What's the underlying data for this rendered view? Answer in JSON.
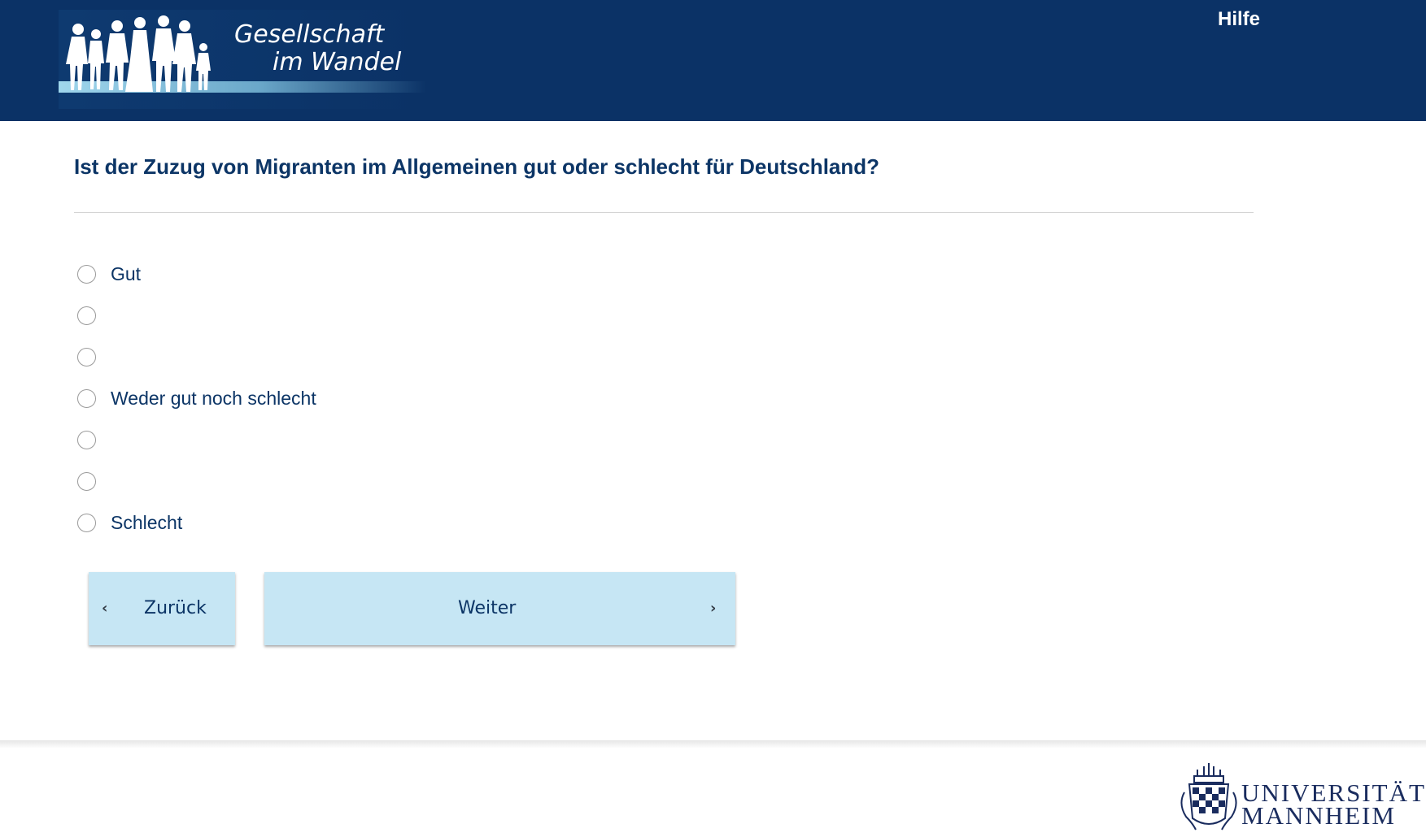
{
  "header": {
    "logo_line1": "Gesellschaft",
    "logo_line2": "im Wandel",
    "help_label": "Hilfe",
    "bg_color": "#0b3266"
  },
  "question": {
    "text": "Ist der Zuzug von Migranten im Allgemeinen gut oder schlecht für Deutschland?"
  },
  "options": [
    {
      "label": "Gut",
      "selected": false
    },
    {
      "label": "",
      "selected": false
    },
    {
      "label": "",
      "selected": false
    },
    {
      "label": "Weder gut noch schlecht",
      "selected": false
    },
    {
      "label": "",
      "selected": false
    },
    {
      "label": "",
      "selected": false
    },
    {
      "label": "Schlecht",
      "selected": false
    }
  ],
  "navigation": {
    "back_label": "Zurück",
    "next_label": "Weiter",
    "button_color": "#c6e6f4"
  },
  "footer": {
    "uni_line1": "UNIVERSITÄT",
    "uni_line2": "MANNHEIM"
  }
}
